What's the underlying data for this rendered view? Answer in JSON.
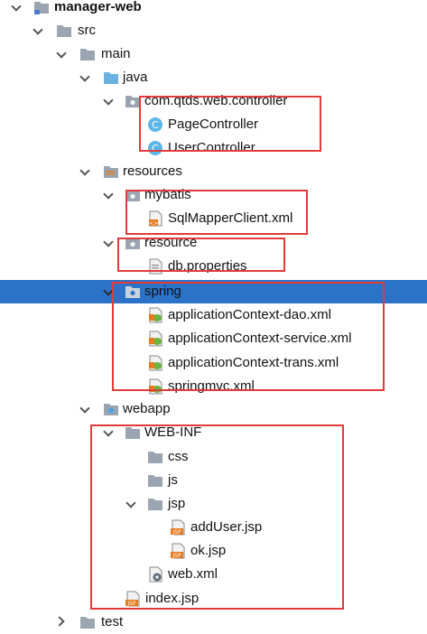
{
  "project": {
    "root": "manager-web",
    "src": "src",
    "main": "main",
    "java": "java",
    "package": "com.qtds.web.controller",
    "classes": [
      "PageController",
      "UserController"
    ],
    "resources": "resources",
    "mybatis": "mybatis",
    "mybatis_files": [
      "SqlMapperClient.xml"
    ],
    "resource": "resource",
    "resource_files": [
      "db.properties"
    ],
    "spring": "spring",
    "spring_files": [
      "applicationContext-dao.xml",
      "applicationContext-service.xml",
      "applicationContext-trans.xml",
      "springmvc.xml"
    ],
    "webapp": "webapp",
    "webinf": "WEB-INF",
    "css": "css",
    "js": "js",
    "jsp": "jsp",
    "jsp_files": [
      "addUser.jsp",
      "ok.jsp"
    ],
    "webxml": "web.xml",
    "index": "index.jsp",
    "test": "test"
  },
  "colors": {
    "selection": "#2a73c8",
    "highlight_box": "#e23b3b",
    "folder": "#9aa5b1",
    "java_folder": "#6cb0e0",
    "class_icon": "#5cb6e8",
    "jsp_badge": "#e77b1f"
  },
  "icons": {
    "folder": "folder-icon",
    "source-folder": "source-folder-icon",
    "package": "package-icon",
    "class": "java-class-icon",
    "xml": "xml-file-icon",
    "spring-xml": "spring-xml-icon",
    "properties": "properties-file-icon",
    "jsp": "jsp-file-icon",
    "webapp": "webapp-folder-icon"
  }
}
